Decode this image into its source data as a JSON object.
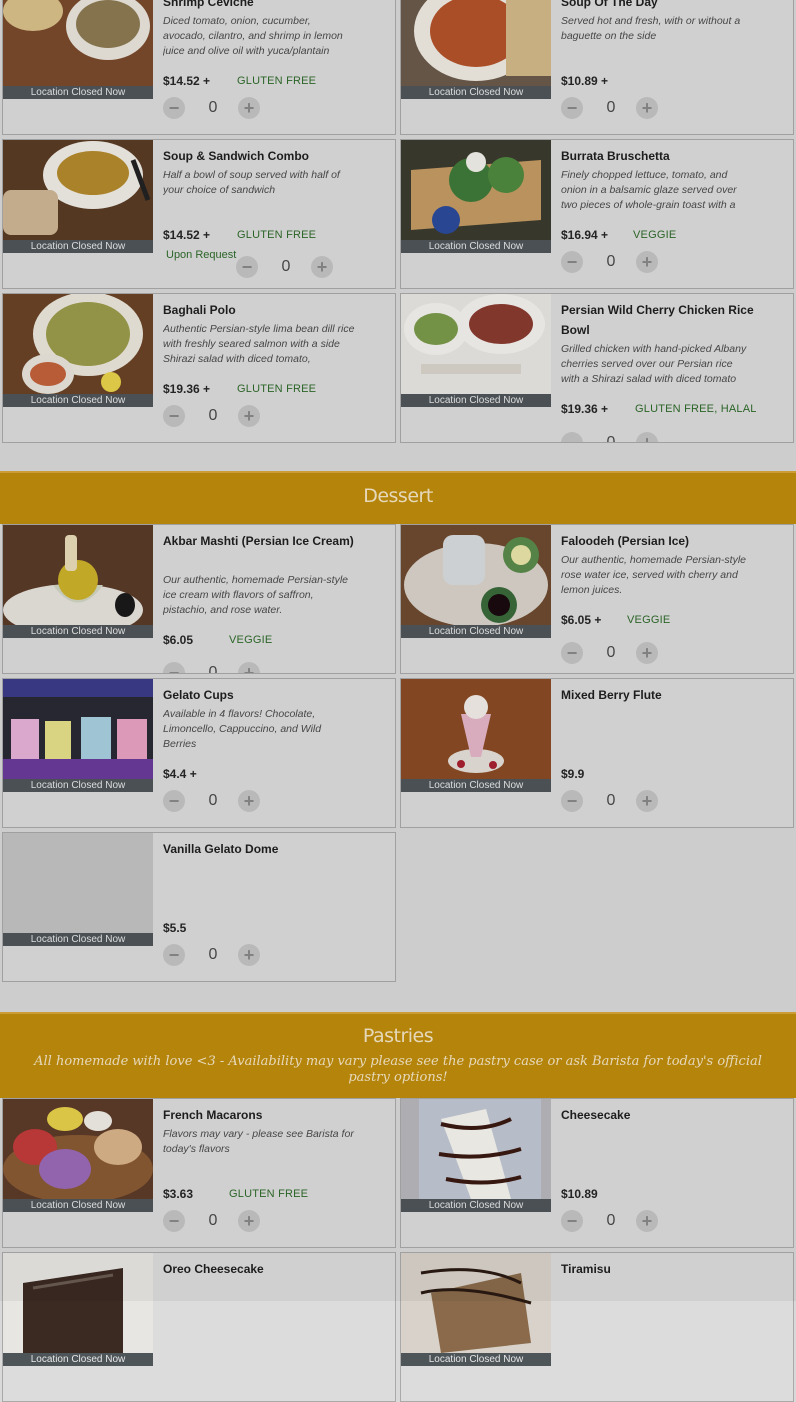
{
  "closed_label": "Location Closed Now",
  "colors": {
    "section_bar": "#bf8c0c",
    "tag_green": "#2e6a2a",
    "closed_bar": "#4e5559"
  },
  "sections": [
    {
      "title": "",
      "items": [
        {
          "name": "Shrimp Ceviche",
          "description": "Diced tomato, onion, cucumber, avocado, cilantro, and shrimp in lemon juice and olive oil with yuca/plantain chips on the side",
          "price": "$14.52 +",
          "tags": [
            "GLUTEN FREE"
          ],
          "quantity": "0",
          "photo": "ceviche"
        },
        {
          "name": "Soup Of The Day",
          "description": "Served hot and fresh, with or without a baguette on the side",
          "price": "$10.89 +",
          "tags": [],
          "quantity": "0",
          "photo": "tomato-soup"
        },
        {
          "name": "Soup & Sandwich Combo",
          "description": "Half a bowl of soup served with half of your choice of sandwich",
          "price": "$14.52 +",
          "tags": [
            "GLUTEN FREE",
            "Upon Request"
          ],
          "quantity": "0",
          "photo": "soup-sandwich"
        },
        {
          "name": "Burrata Bruschetta",
          "description": "Finely chopped lettuce, tomato, and onion in a balsamic glaze served over two pieces of whole-grain toast with a burrata"
        },
        {
          "name": "Baghali Polo",
          "description": "Authentic Persian-style lima bean dill rice with freshly seared salmon with a side Shirazi salad with diced tomato, cucumber",
          "price": "$19.36 +",
          "tags": [
            "GLUTEN FREE"
          ],
          "quantity": "0",
          "photo": "baghali-polo"
        },
        {
          "name": "Persian Wild Cherry Chicken Rice Bowl",
          "description": "Grilled chicken with hand-picked Albany cherries served over our Persian rice with a Shirazi salad with diced tomato and cucumber",
          "price": "$19.36 +",
          "tags": [
            "GLUTEN FREE, HALAL"
          ],
          "quantity": "0",
          "photo": "cherry-rice-bowl"
        }
      ]
    },
    {
      "title": "Dessert",
      "items": [
        {
          "name": "Akbar Mashti (Persian Ice Cream)",
          "description": "Our authentic, homemade Persian-style ice cream with flavors of saffron, pistachio, and rose water.",
          "price": "$6.05",
          "tags": [
            "VEGGIE"
          ],
          "quantity": "0",
          "photo": "ice-cream"
        },
        {
          "name": "Faloodeh (Persian Ice)",
          "description": "Our authentic, homemade Persian-style rose water ice, served with cherry and lemon juices.",
          "price": "$6.05 +",
          "tags": [
            "VEGGIE"
          ],
          "quantity": "0",
          "photo": "faloodeh"
        },
        {
          "name": "Gelato Cups",
          "description": "Available in 4 flavors! Chocolate, Limoncello, Cappuccino, and Wild Berries",
          "price": "$4.4 +",
          "tags": [],
          "quantity": "0",
          "photo": "gelato-cups"
        },
        {
          "name": "Mixed Berry Flute",
          "description": "",
          "price": "$9.9",
          "tags": [],
          "quantity": "0",
          "photo": "berry-flute"
        },
        {
          "name": "Vanilla Gelato Dome",
          "description": "",
          "price": "$5.5",
          "tags": [],
          "quantity": "0",
          "photo": "placeholder"
        }
      ]
    },
    {
      "title": "Pastries",
      "subtitle": "All homemade with love <3 - Availability may vary please see the pastry case or ask Barista for today's official pastry options!",
      "items": [
        {
          "name": "French Macarons",
          "description": "Flavors may vary - please see Barista for today's flavors",
          "price": "$3.63",
          "tags": [
            "GLUTEN FREE"
          ],
          "quantity": "0",
          "photo": "macarons"
        },
        {
          "name": "Cheesecake",
          "description": "",
          "price": "$10.89",
          "tags": [],
          "quantity": "0",
          "photo": "cheesecake"
        },
        {
          "name": "Oreo Cheesecake",
          "photo": "oreo-cheesecake"
        },
        {
          "name": "Tiramisu",
          "photo": "tiramisu"
        }
      ]
    }
  ]
}
